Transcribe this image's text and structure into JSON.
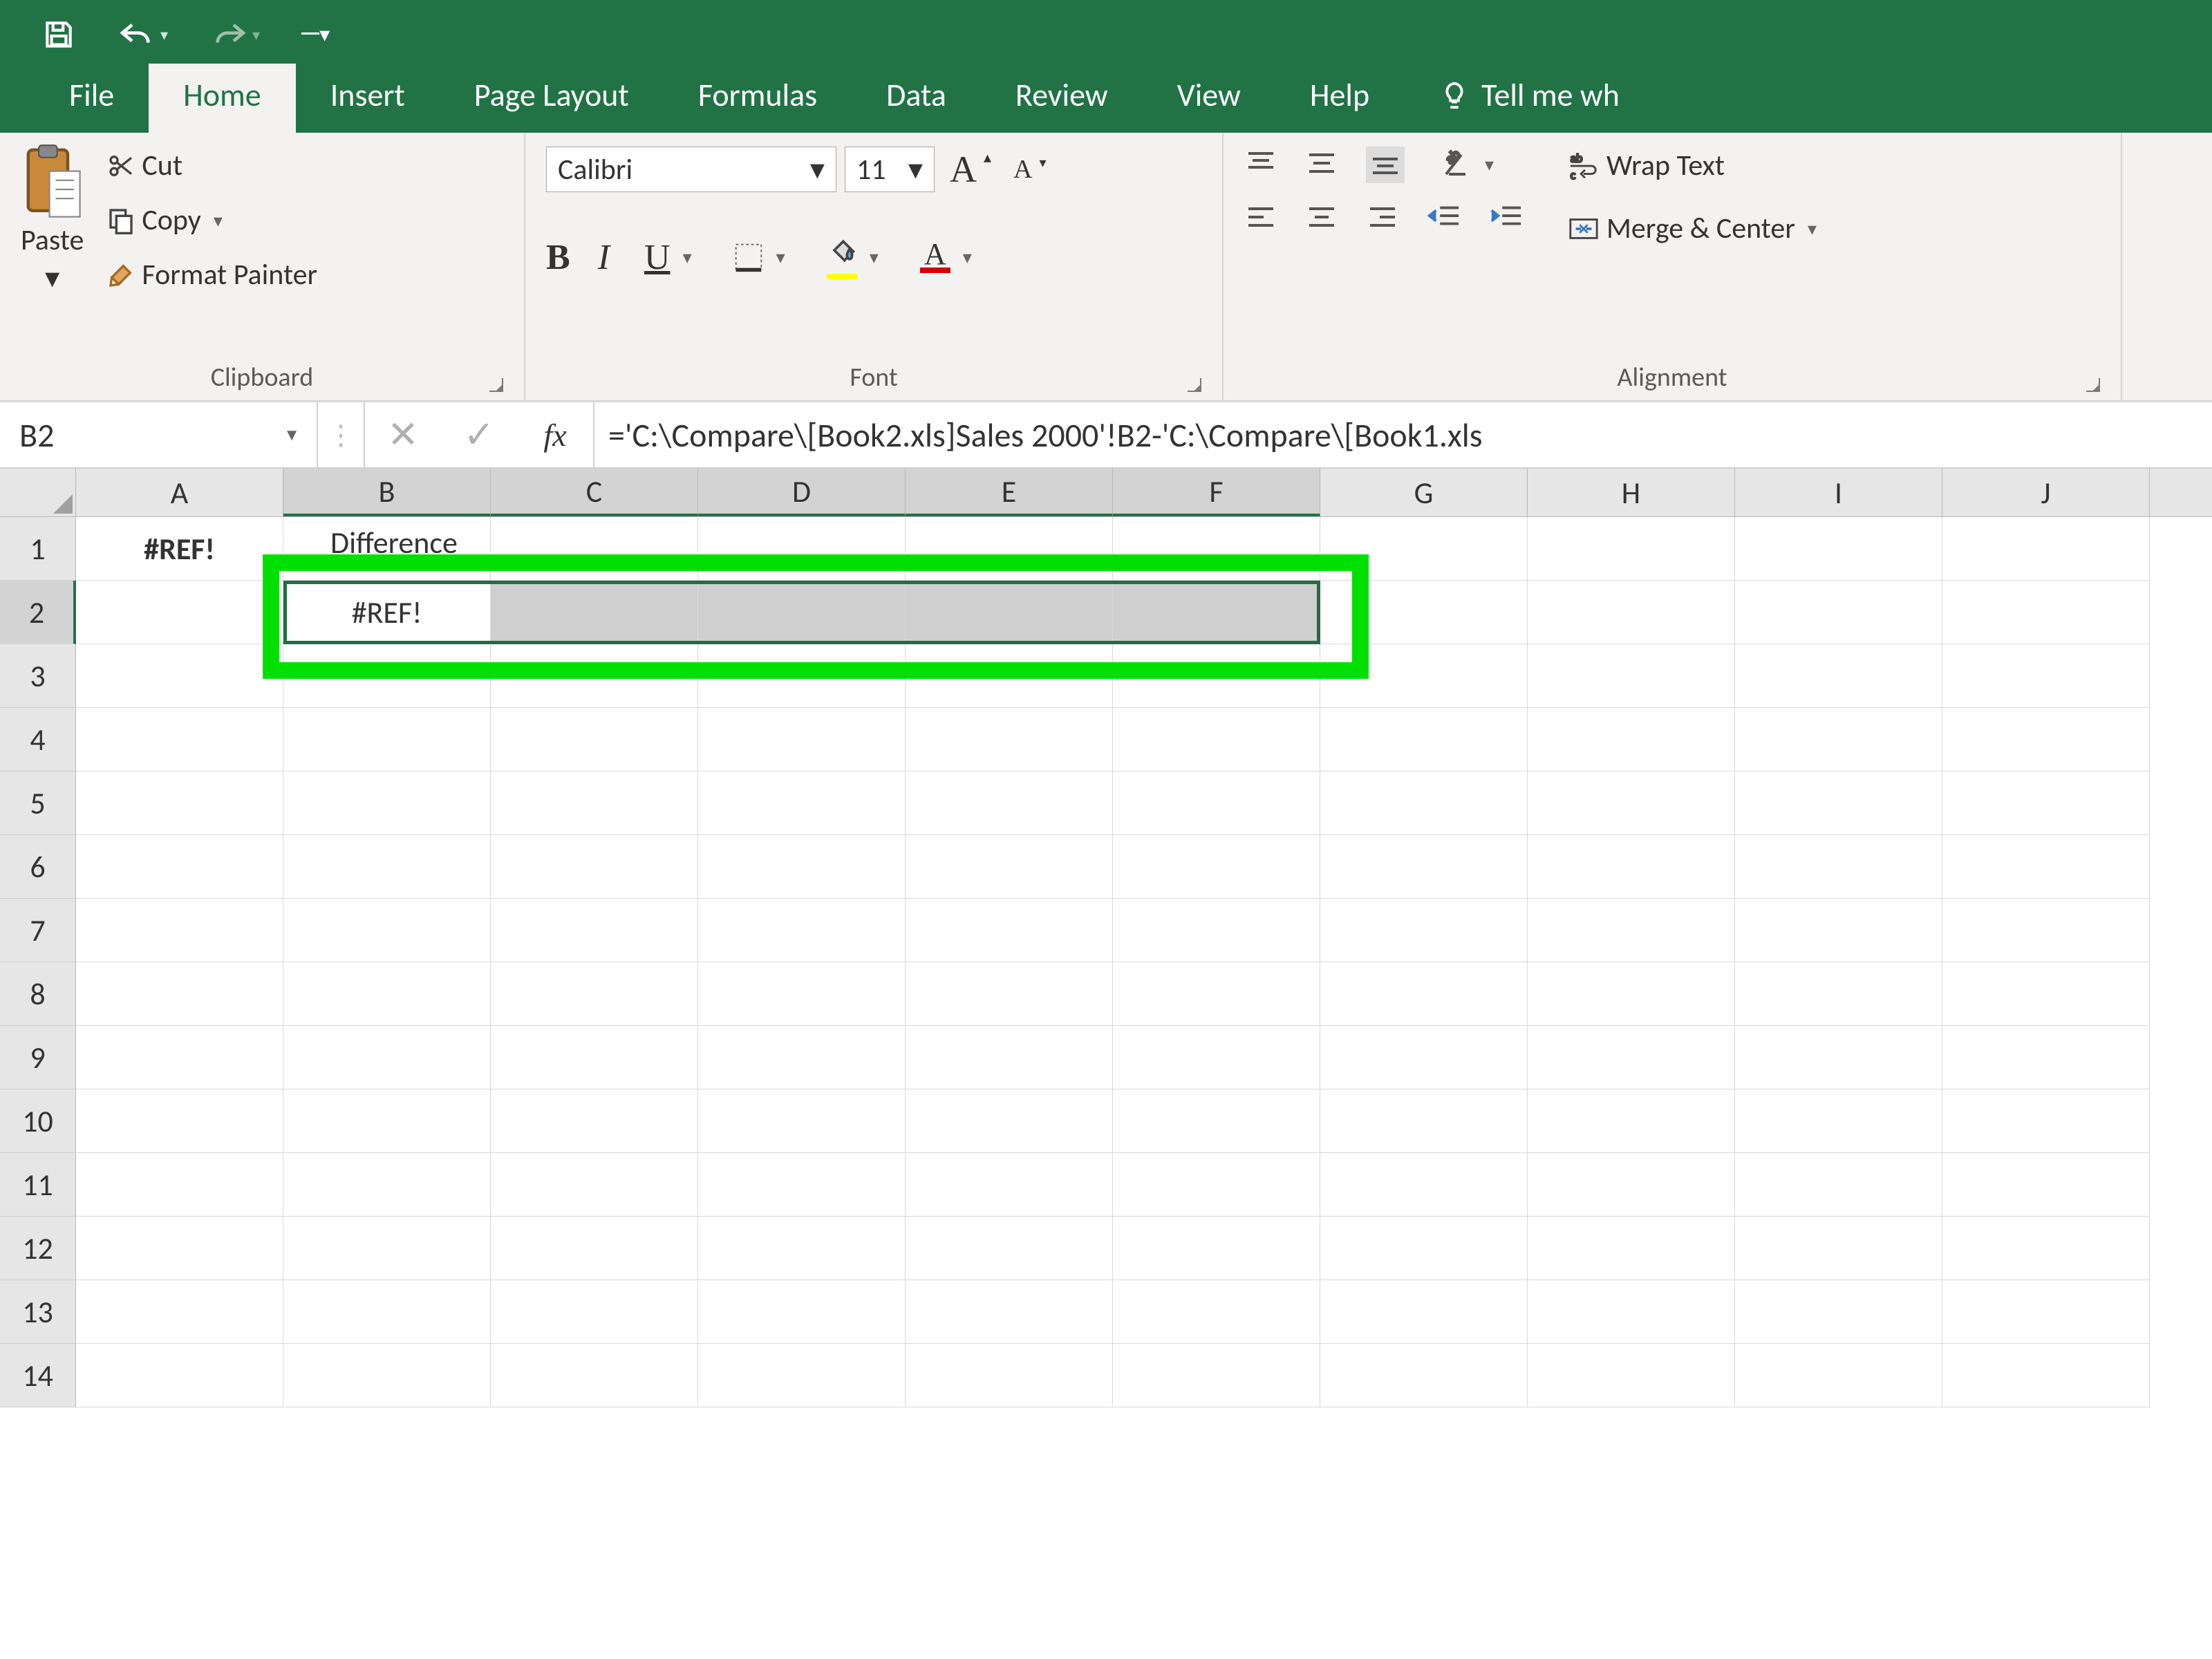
{
  "qat": {
    "save": "Save",
    "undo": "Undo",
    "redo": "Redo",
    "customize": "Customize Quick Access Toolbar"
  },
  "tabs": {
    "file": "File",
    "home": "Home",
    "insert": "Insert",
    "page_layout": "Page Layout",
    "formulas": "Formulas",
    "data": "Data",
    "review": "Review",
    "view": "View",
    "help": "Help",
    "tell_me": "Tell me wh"
  },
  "ribbon": {
    "clipboard": {
      "label": "Clipboard",
      "paste": "Paste",
      "cut": "Cut",
      "copy": "Copy",
      "format_painter": "Format Painter"
    },
    "font": {
      "label": "Font",
      "name": "Calibri",
      "size": "11",
      "bold": "B",
      "italic": "I",
      "underline": "U",
      "increase": "A",
      "decrease": "A"
    },
    "alignment": {
      "label": "Alignment",
      "wrap": "Wrap Text",
      "merge": "Merge & Center"
    }
  },
  "namebox": {
    "value": "B2"
  },
  "formula_bar": {
    "fx": "fx",
    "value": "='C:\\Compare\\[Book2.xls]Sales 2000'!B2-'C:\\Compare\\[Book1.xls"
  },
  "columns": [
    "A",
    "B",
    "C",
    "D",
    "E",
    "F",
    "G",
    "H",
    "I",
    "J"
  ],
  "rows": [
    "1",
    "2",
    "3",
    "4",
    "5",
    "6",
    "7",
    "8",
    "9",
    "10",
    "11",
    "12",
    "13",
    "14"
  ],
  "cells": {
    "A1": "#REF!",
    "B1_partial": "Difference",
    "B2": "#REF!"
  },
  "selection": {
    "active": "B2",
    "range": "B2:F2"
  },
  "colors": {
    "brand": "#217346",
    "highlight": "#00e000"
  }
}
